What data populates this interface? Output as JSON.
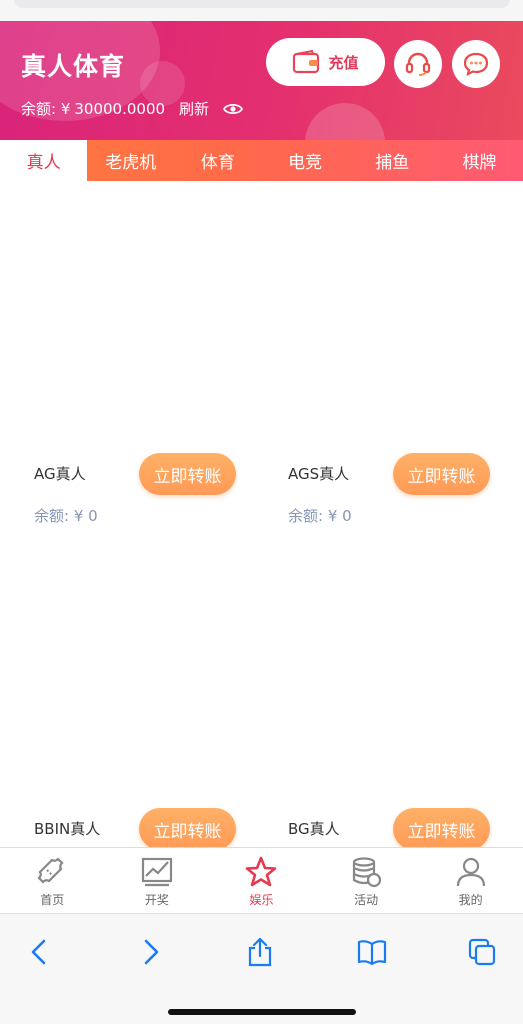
{
  "header": {
    "title": "真人体育",
    "balance_label": "余额: ¥",
    "balance_value": "30000.0000",
    "refresh_label": "刷新",
    "recharge_label": "充值",
    "accent": "#e4306e"
  },
  "tabs": [
    {
      "label": "真人",
      "active": true
    },
    {
      "label": "老虎机"
    },
    {
      "label": "体育"
    },
    {
      "label": "电竞"
    },
    {
      "label": "捕鱼"
    },
    {
      "label": "棋牌"
    }
  ],
  "games": [
    {
      "name": "AG真人",
      "button": "立即转账",
      "balance": "余额: ¥ 0"
    },
    {
      "name": "AGS真人",
      "button": "立即转账",
      "balance": "余额: ¥ 0"
    },
    {
      "name": "BBIN真人",
      "button": "立即转账"
    },
    {
      "name": "BG真人",
      "button": "立即转账"
    }
  ],
  "bottom_nav": [
    {
      "label": "首页",
      "icon": "ticket-icon"
    },
    {
      "label": "开奖",
      "icon": "trend-chart-icon"
    },
    {
      "label": "娱乐",
      "icon": "star-icon",
      "active": true
    },
    {
      "label": "活动",
      "icon": "coins-icon"
    },
    {
      "label": "我的",
      "icon": "user-icon"
    }
  ],
  "browser": {
    "icons": [
      "back-icon",
      "forward-icon",
      "share-icon",
      "bookmarks-icon",
      "tabs-icon"
    ],
    "tint": "#1a7cf0"
  }
}
